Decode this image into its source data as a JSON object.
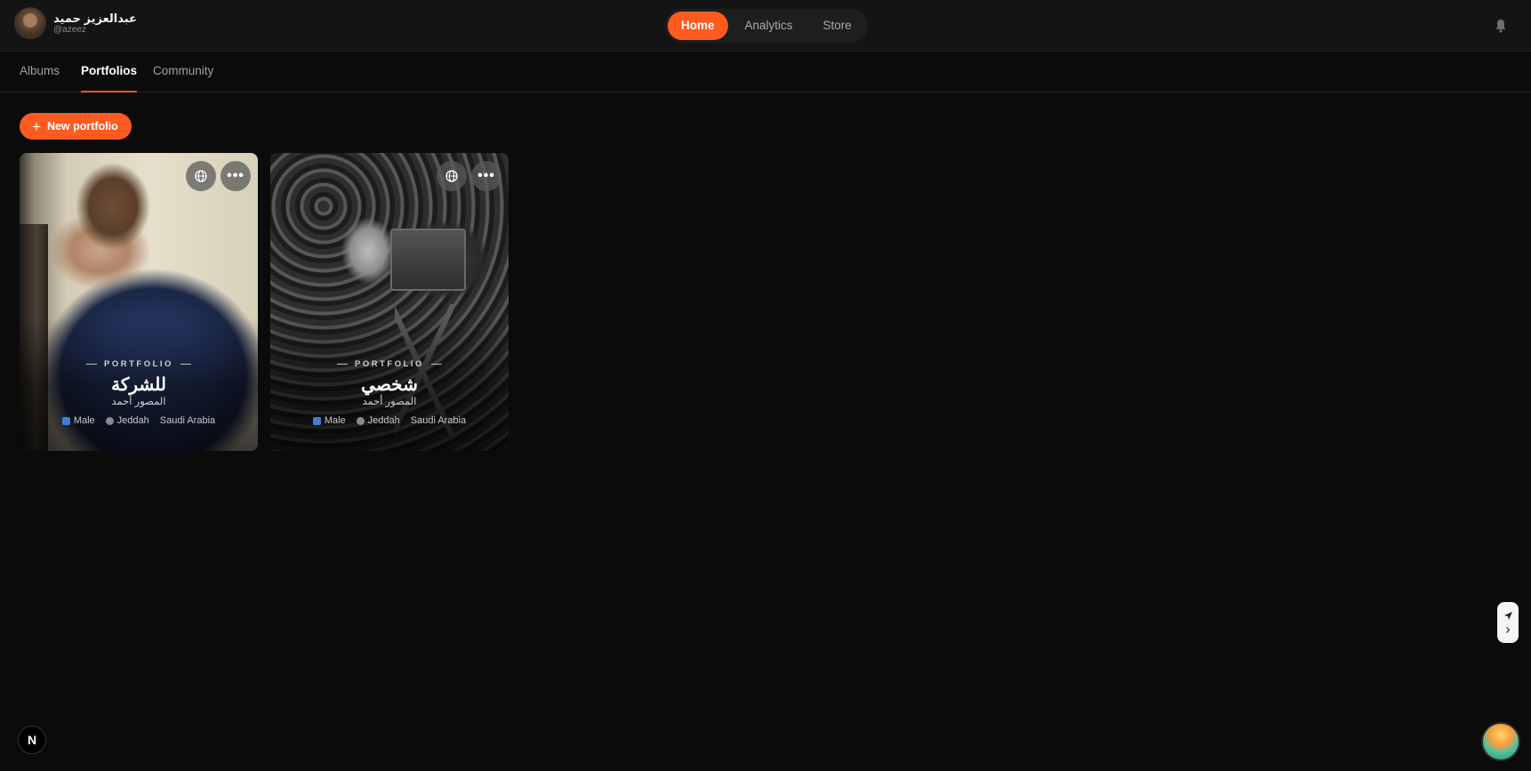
{
  "user": {
    "name": "عبدالعزيز حميد",
    "handle": "@azeez"
  },
  "main_nav": [
    {
      "label": "Home",
      "active": true
    },
    {
      "label": "Analytics",
      "active": false
    },
    {
      "label": "Store",
      "active": false
    }
  ],
  "sub_tabs": [
    {
      "label": "Albums",
      "active": false
    },
    {
      "label": "Portfolios",
      "active": true
    },
    {
      "label": "Community",
      "active": false
    }
  ],
  "new_portfolio": {
    "plus": "+",
    "label": "New portfolio"
  },
  "portfolios": [
    {
      "kicker": "PORTFOLIO",
      "title": "للشركة",
      "subtitle": "المصور أحمد",
      "gender": "Male",
      "city": "Jeddah",
      "country": "Saudi Arabia",
      "more": "•••"
    },
    {
      "kicker": "PORTFOLIO",
      "title": "شخصي",
      "subtitle": "المصور أحمد",
      "gender": "Male",
      "city": "Jeddah",
      "country": "Saudi Arabia",
      "more": "•••"
    }
  ],
  "next_badge": "N",
  "colors": {
    "accent": "#ff5a1f",
    "background": "#0b0b0b",
    "topbar": "#141414"
  },
  "icons": [
    "bell-icon",
    "globe-icon",
    "more-icon",
    "gender-icon",
    "location-icon",
    "send-icon",
    "chevron-right-icon",
    "plus-icon"
  ]
}
